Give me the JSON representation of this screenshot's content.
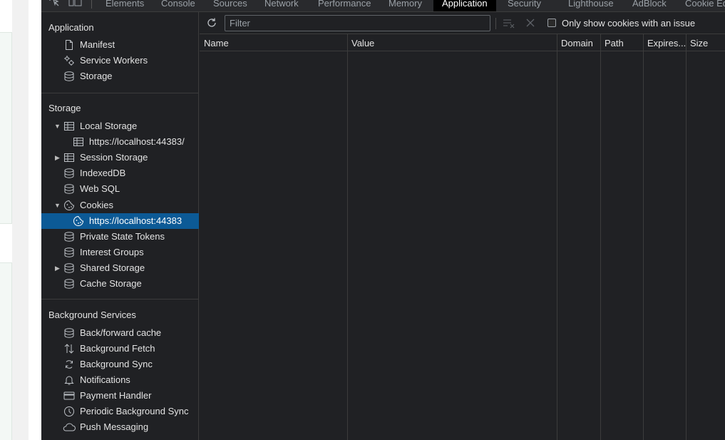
{
  "tabs": [
    {
      "label": "Elements"
    },
    {
      "label": "Console"
    },
    {
      "label": "Sources"
    },
    {
      "label": "Network"
    },
    {
      "label": "Performance"
    },
    {
      "label": "Memory"
    },
    {
      "label": "Application"
    },
    {
      "label": "Security"
    },
    {
      "label": "Lighthouse"
    },
    {
      "label": "AdBlock"
    },
    {
      "label": "Cookie Ed"
    }
  ],
  "sidebar": {
    "application": {
      "title": "Application",
      "items": [
        {
          "label": "Manifest",
          "icon": "document-icon"
        },
        {
          "label": "Service Workers",
          "icon": "gears-icon"
        },
        {
          "label": "Storage",
          "icon": "database-icon"
        }
      ]
    },
    "storage": {
      "title": "Storage",
      "items": [
        {
          "label": "Local Storage",
          "icon": "table-icon"
        },
        {
          "label": "https://localhost:44383/",
          "icon": "table-icon"
        },
        {
          "label": "Session Storage",
          "icon": "table-icon"
        },
        {
          "label": "IndexedDB",
          "icon": "database-icon"
        },
        {
          "label": "Web SQL",
          "icon": "database-icon"
        },
        {
          "label": "Cookies",
          "icon": "cookie-icon"
        },
        {
          "label": "https://localhost:44383",
          "icon": "cookie-icon"
        },
        {
          "label": "Private State Tokens",
          "icon": "database-icon"
        },
        {
          "label": "Interest Groups",
          "icon": "database-icon"
        },
        {
          "label": "Shared Storage",
          "icon": "database-icon"
        },
        {
          "label": "Cache Storage",
          "icon": "database-icon"
        }
      ]
    },
    "background": {
      "title": "Background Services",
      "items": [
        {
          "label": "Back/forward cache",
          "icon": "database-icon"
        },
        {
          "label": "Background Fetch",
          "icon": "arrows-updown-icon"
        },
        {
          "label": "Background Sync",
          "icon": "sync-icon"
        },
        {
          "label": "Notifications",
          "icon": "bell-icon"
        },
        {
          "label": "Payment Handler",
          "icon": "card-icon"
        },
        {
          "label": "Periodic Background Sync",
          "icon": "clock-icon"
        },
        {
          "label": "Push Messaging",
          "icon": "cloud-icon"
        }
      ]
    }
  },
  "toolbar": {
    "filter_placeholder": "Filter",
    "only_issue_label": "Only show cookies with an issue"
  },
  "table": {
    "columns": [
      "Name",
      "Value",
      "Domain",
      "Path",
      "Expires...",
      "Size"
    ]
  },
  "colors": {
    "selected": "#0c5a96",
    "background": "#202124",
    "border": "#3c3c3c"
  }
}
